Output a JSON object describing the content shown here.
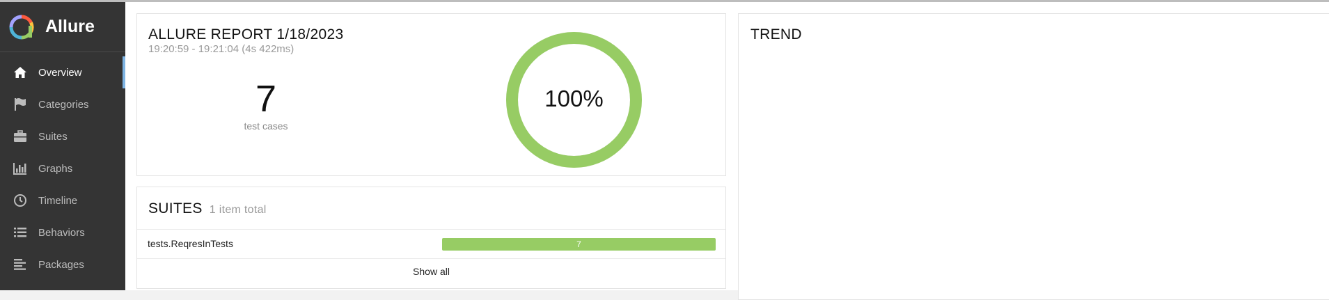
{
  "app": {
    "name": "Allure"
  },
  "sidebar": {
    "items": [
      {
        "label": "Overview",
        "icon": "home-icon",
        "active": true
      },
      {
        "label": "Categories",
        "icon": "flag-icon",
        "active": false
      },
      {
        "label": "Suites",
        "icon": "briefcase-icon",
        "active": false
      },
      {
        "label": "Graphs",
        "icon": "bar-chart-icon",
        "active": false
      },
      {
        "label": "Timeline",
        "icon": "clock-icon",
        "active": false
      },
      {
        "label": "Behaviors",
        "icon": "list-icon",
        "active": false
      },
      {
        "label": "Packages",
        "icon": "align-left-icon",
        "active": false
      }
    ]
  },
  "summary": {
    "title": "ALLURE REPORT 1/18/2023",
    "time": "19:20:59 - 19:21:04 (4s 422ms)",
    "test_count": "7",
    "test_label": "test cases",
    "pass_percent_label": "100%",
    "pass_fraction": 1.0
  },
  "suites": {
    "title": "SUITES",
    "subtitle": "1 item total",
    "rows": [
      {
        "name": "tests.ReqresInTests",
        "passed": 7
      }
    ],
    "show_all": "Show all"
  },
  "trend": {
    "title": "TREND"
  },
  "colors": {
    "sidebar_bg": "#343434",
    "active_indicator": "#7eb4e3",
    "passed": "#97cc64"
  }
}
